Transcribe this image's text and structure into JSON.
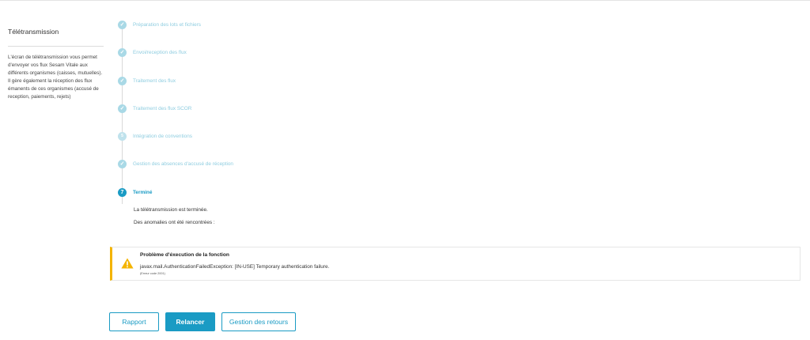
{
  "sidebar": {
    "title": "Télétransmission",
    "description": "L'écran de télétransmission vous permet d'envoyer vos flux Sesam Vitale aux différents organismes (caisses, mutuelles). Il gère également la réception des flux émanents de ces organismes (accusé de reception, paiements, rejets)"
  },
  "steps": [
    {
      "label": "Préparation des lots et fichiers",
      "icon": "check",
      "status": "done"
    },
    {
      "label": "Envoi/reception des flux",
      "icon": "check",
      "status": "done"
    },
    {
      "label": "Traitement des flux",
      "icon": "check",
      "status": "done"
    },
    {
      "label": "Traitement des flux SCOR",
      "icon": "check",
      "status": "done"
    },
    {
      "label": "Intégration de conventions",
      "number": "5",
      "status": "pending"
    },
    {
      "label": "Gestion des absences d'accusé de réception",
      "icon": "check",
      "status": "done"
    },
    {
      "label": "Terminé",
      "number": "7",
      "status": "active"
    }
  ],
  "result": {
    "line1": "La télétransmission est terminée.",
    "line2": "Des anomalies ont été rencontrées :"
  },
  "alert": {
    "title": "Problème d'éxecution de la fonction",
    "message": "javax.mail.AuthenticationFailedException: [IN-USE] Temporary authentication failure.",
    "code": "(Erreur code 2001)",
    "color": "#f4b400"
  },
  "buttons": {
    "rapport": "Rapport",
    "relancer": "Relancer",
    "gestion": "Gestion des retours"
  },
  "colors": {
    "accent": "#1a9bc4",
    "done": "#a9d9e6",
    "warning": "#f4b400"
  }
}
